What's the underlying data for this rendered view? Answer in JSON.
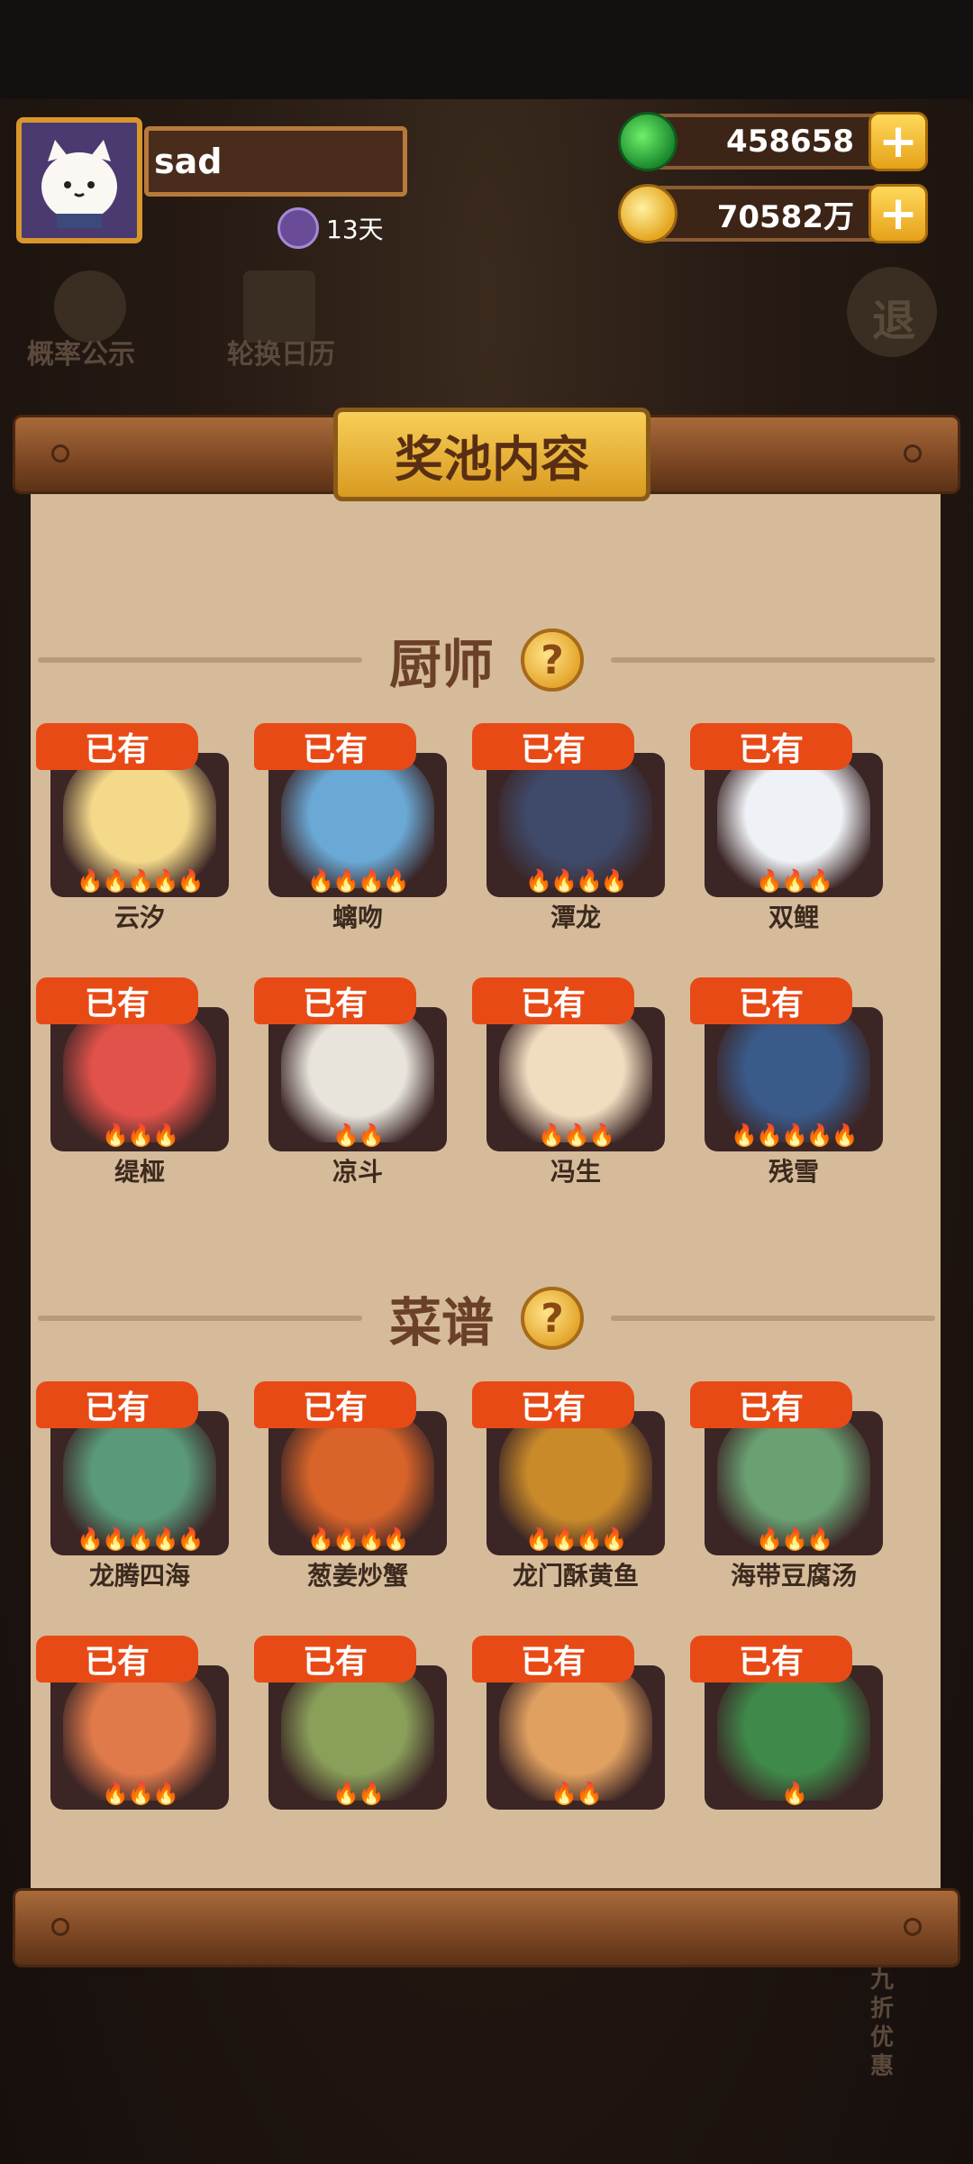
{
  "player": {
    "name": "sad",
    "days": "13天"
  },
  "currency": {
    "jade": "458658",
    "coins": "70582万",
    "plus_glyph": "+"
  },
  "background_buttons": {
    "probability": "概率公示",
    "calendar": "轮换日历",
    "exit_glyph": "退"
  },
  "panel": {
    "title": "奖池内容",
    "help_glyph": "?",
    "chef_section": "厨师",
    "recipe_section": "菜谱"
  },
  "chefs": [
    {
      "badge": "已有",
      "name": "云汐",
      "stars": "🔥🔥🔥🔥🔥",
      "color": "#f4d98a"
    },
    {
      "badge": "已有",
      "name": "螭吻",
      "stars": "🔥🔥🔥🔥",
      "color": "#6aa9d6"
    },
    {
      "badge": "已有",
      "name": "潭龙",
      "stars": "🔥🔥🔥🔥",
      "color": "#3f4a6a"
    },
    {
      "badge": "已有",
      "name": "双鲤",
      "stars": "🔥🔥🔥",
      "color": "#eef1f5"
    },
    {
      "badge": "已有",
      "name": "缇桠",
      "stars": "🔥🔥🔥",
      "color": "#e0524a"
    },
    {
      "badge": "已有",
      "name": "凉斗",
      "stars": "🔥🔥",
      "color": "#e8e4dc"
    },
    {
      "badge": "已有",
      "name": "冯生",
      "stars": "🔥🔥🔥",
      "color": "#f2dcc0"
    },
    {
      "badge": "已有",
      "name": "残雪",
      "stars": "🔥🔥🔥🔥🔥",
      "color": "#3a5a8a"
    }
  ],
  "recipes": [
    {
      "badge": "已有",
      "name": "龙腾四海",
      "stars": "🔥🔥🔥🔥🔥",
      "color": "#5a9a7a"
    },
    {
      "badge": "已有",
      "name": "葱姜炒蟹",
      "stars": "🔥🔥🔥🔥",
      "color": "#d8642a"
    },
    {
      "badge": "已有",
      "name": "龙门酥黄鱼",
      "stars": "🔥🔥🔥🔥",
      "color": "#c98a2a"
    },
    {
      "badge": "已有",
      "name": "海带豆腐汤",
      "stars": "🔥🔥🔥",
      "color": "#6aa072"
    },
    {
      "badge": "已有",
      "name": "",
      "stars": "🔥🔥🔥",
      "color": "#e07a4a"
    },
    {
      "badge": "已有",
      "name": "",
      "stars": "🔥🔥",
      "color": "#8aa05a"
    },
    {
      "badge": "已有",
      "name": "",
      "stars": "🔥🔥",
      "color": "#e0a060"
    },
    {
      "badge": "已有",
      "name": "",
      "stars": "🔥",
      "color": "#3f8a4a"
    }
  ],
  "bottom_hints": {
    "promo": "九折优惠"
  }
}
